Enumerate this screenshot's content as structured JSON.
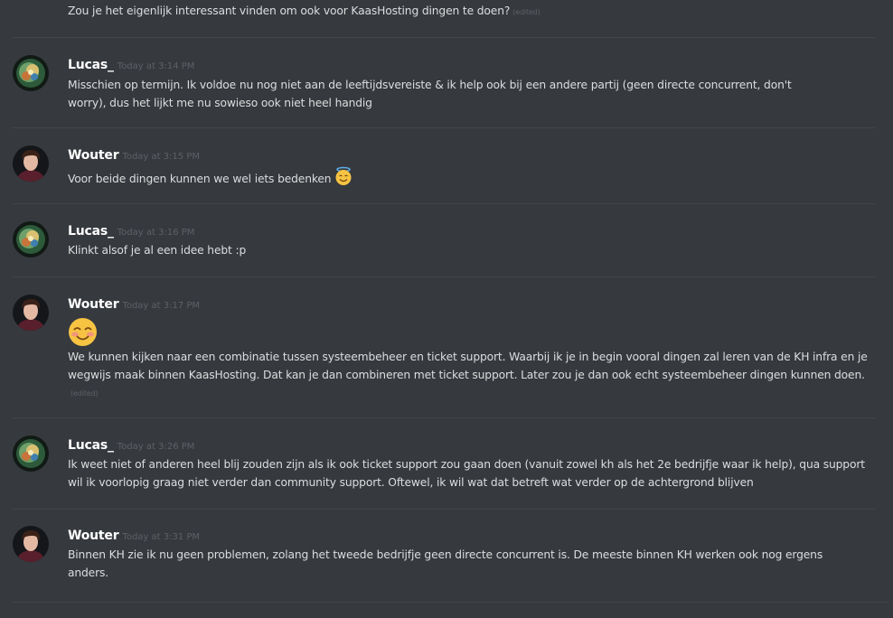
{
  "messages": [
    {
      "text": "Zou je het eigenlijk interessant vinden om ook voor KaasHosting dingen te doen?",
      "edited": "(edited)"
    },
    {
      "username": "Lucas_",
      "timestamp": "Today at 3:14 PM",
      "text": "Misschien op termijn. Ik voldoe nu nog niet aan de leeftijdsvereiste & ik help ook bij een andere partij (geen directe concurrent, don't worry), dus het lijkt me nu sowieso ook niet heel handig"
    },
    {
      "username": "Wouter",
      "timestamp": "Today at 3:15 PM",
      "text": "Voor beide dingen kunnen we wel iets bedenken",
      "emoji": "innocent-emoji"
    },
    {
      "username": "Lucas_",
      "timestamp": "Today at 3:16 PM",
      "text": "Klinkt alsof je al een idee hebt :p"
    },
    {
      "username": "Wouter",
      "timestamp": "Today at 3:17 PM",
      "emoji": "blush-emoji",
      "text": "We kunnen kijken naar een combinatie tussen systeembeheer en ticket support.  Waarbij ik je in begin vooral dingen zal leren van de KH infra en je wegwijs maak binnen KaasHosting. Dat kan je dan combineren met ticket support. Later zou je dan ook echt systeembeheer dingen kunnen doen.",
      "edited": "(edited)"
    },
    {
      "username": "Lucas_",
      "timestamp": "Today at 3:26 PM",
      "text": "Ik weet niet of anderen heel blij zouden zijn als ik ook ticket support zou gaan doen (vanuit zowel kh als het 2e bedrijfje waar ik help), qua support wil ik voorlopig graag niet verder dan community support. Oftewel, ik wil wat dat betreft wat verder op de achtergrond blijven"
    },
    {
      "username": "Wouter",
      "timestamp": "Today at 3:31 PM",
      "text": "Binnen KH zie ik nu geen problemen, zolang het tweede bedrijfje geen directe concurrent is. De meeste binnen KH werken ook nog ergens anders."
    }
  ],
  "colors": {
    "background": "#36393e",
    "username": "#ffffff",
    "timestamp": "#5d6166",
    "text": "#dcddde",
    "divider": "#42454a"
  }
}
